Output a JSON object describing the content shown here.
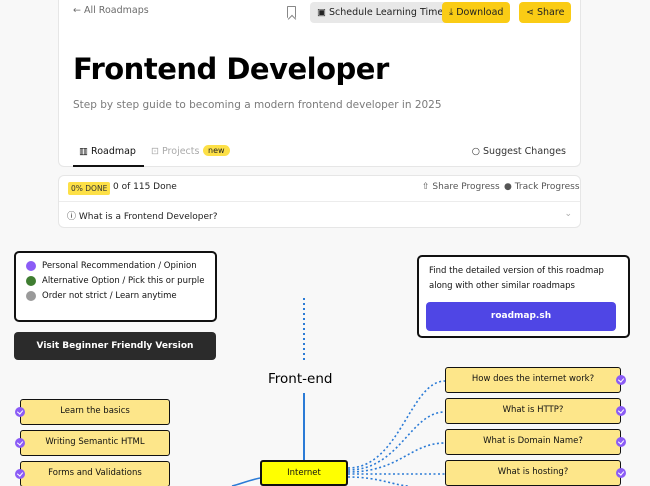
{
  "header": {
    "back_link": "← All Roadmaps",
    "buttons": {
      "schedule": "Schedule Learning Time",
      "download": "Download",
      "share": "Share"
    },
    "title": "Frontend Developer",
    "subtitle": "Step by step guide to becoming a modern frontend developer in 2025",
    "tabs": {
      "roadmap": "Roadmap",
      "projects": "Projects",
      "projects_badge": "new"
    },
    "suggest": "Suggest Changes"
  },
  "progress": {
    "percent_badge": "0% DONE",
    "done_text": "0 of 115 Done",
    "share_progress": "Share Progress",
    "track_progress": "Track Progress",
    "faq_question": "What is a Frontend Developer?"
  },
  "legend": {
    "items": [
      {
        "label": "Personal Recommendation / Opinion",
        "color": "#8b5cf6"
      },
      {
        "label": "Alternative Option / Pick this or purple",
        "color": "#3f7d31"
      },
      {
        "label": "Order not strict / Learn anytime",
        "color": "#9a9a9a"
      }
    ]
  },
  "visit_button": "Visit Beginner Friendly Version",
  "detail_box": {
    "text": "Find the detailed version of this roadmap along with other similar roadmaps",
    "button": "roadmap.sh"
  },
  "roadmap": {
    "root": "Front-end",
    "hub": "Internet",
    "left_nodes": [
      "Learn the basics",
      "Writing Semantic HTML",
      "Forms and Validations"
    ],
    "right_nodes": [
      "How does the internet work?",
      "What is HTTP?",
      "What is Domain Name?",
      "What is hosting?"
    ]
  },
  "colors": {
    "accent": "#facc15",
    "purple": "#8b5cf6",
    "node_fill": "#fde68a",
    "hub_fill": "#ffff00",
    "link_blue": "#2b7bd6",
    "button_indigo": "#4f46e5"
  }
}
